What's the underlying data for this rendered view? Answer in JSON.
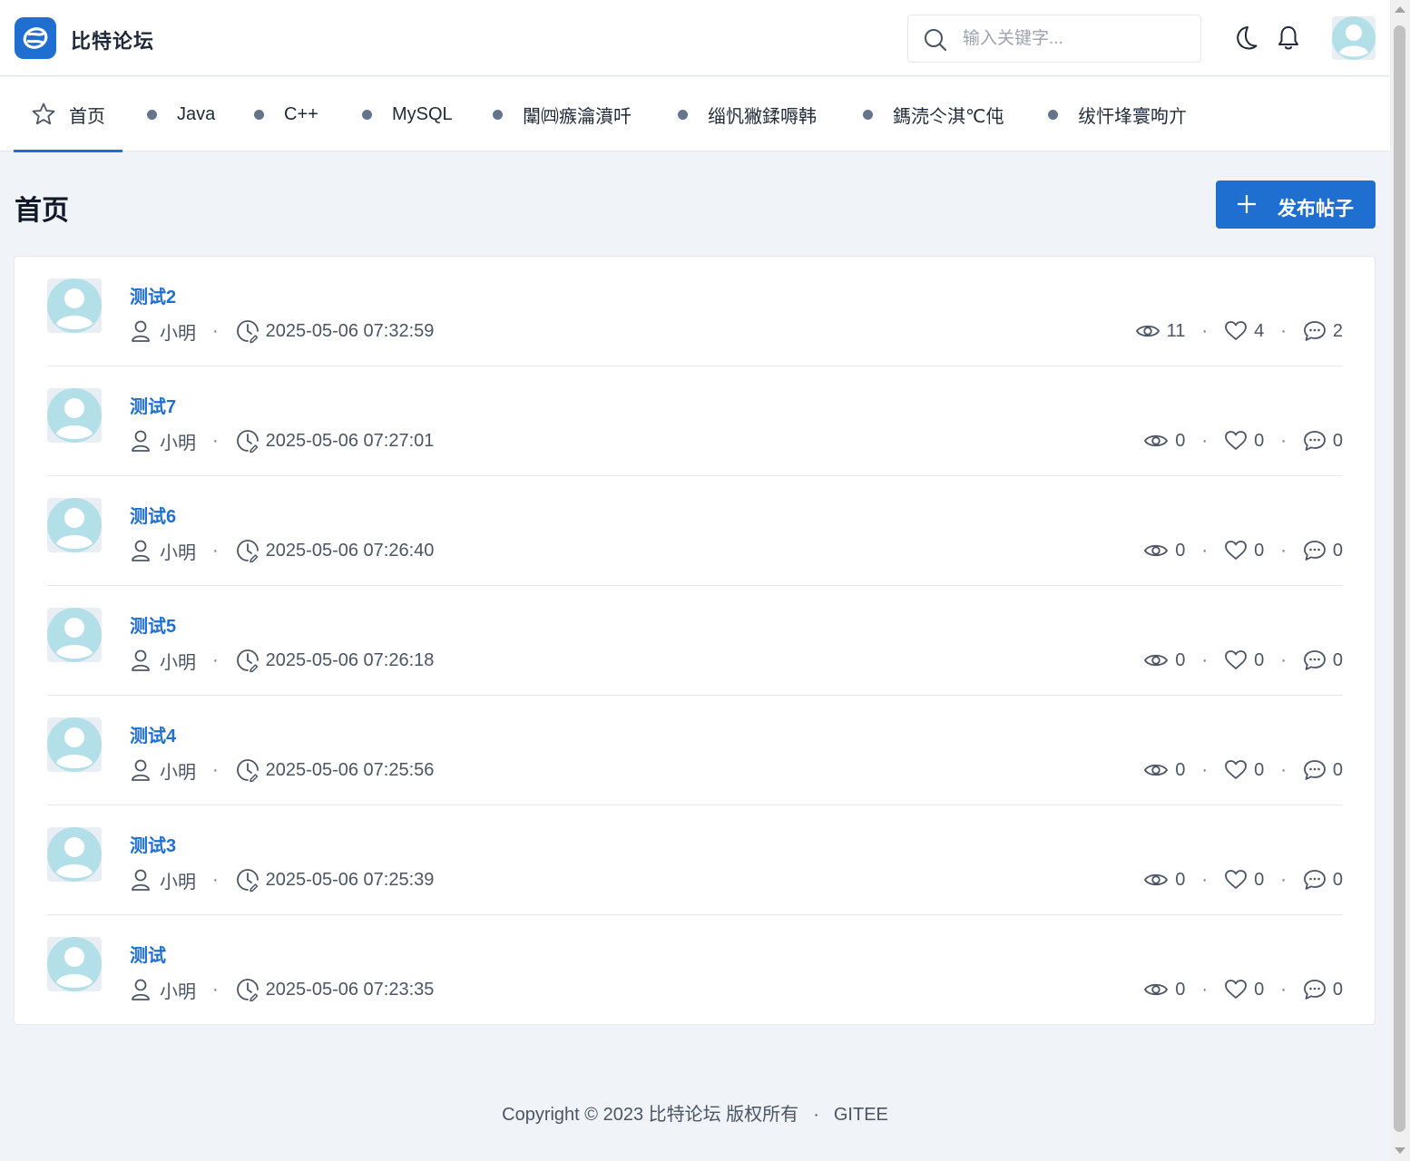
{
  "header": {
    "brand": "比特论坛",
    "search_placeholder": "输入关键字...",
    "search_value": ""
  },
  "nav": {
    "items": [
      {
        "label": "首页",
        "icon": "star-icon",
        "active": true
      },
      {
        "label": "Java"
      },
      {
        "label": "C++"
      },
      {
        "label": "MySQL"
      },
      {
        "label": "闈㈣瘯瀹濆吀"
      },
      {
        "label": "缁忛獙鍒嗕韩"
      },
      {
        "label": "鎷涜仒淇℃伅"
      },
      {
        "label": "绂忓埄寰呴亣"
      }
    ]
  },
  "page": {
    "title": "首页",
    "publish_label": "发布帖子"
  },
  "posts": [
    {
      "title": "测试2",
      "author": "小明",
      "time": "2025-05-06 07:32:59",
      "views": "11",
      "likes": "4",
      "comments": "2"
    },
    {
      "title": "测试7",
      "author": "小明",
      "time": "2025-05-06 07:27:01",
      "views": "0",
      "likes": "0",
      "comments": "0"
    },
    {
      "title": "测试6",
      "author": "小明",
      "time": "2025-05-06 07:26:40",
      "views": "0",
      "likes": "0",
      "comments": "0"
    },
    {
      "title": "测试5",
      "author": "小明",
      "time": "2025-05-06 07:26:18",
      "views": "0",
      "likes": "0",
      "comments": "0"
    },
    {
      "title": "测试4",
      "author": "小明",
      "time": "2025-05-06 07:25:56",
      "views": "0",
      "likes": "0",
      "comments": "0"
    },
    {
      "title": "测试3",
      "author": "小明",
      "time": "2025-05-06 07:25:39",
      "views": "0",
      "likes": "0",
      "comments": "0"
    },
    {
      "title": "测试",
      "author": "小明",
      "time": "2025-05-06 07:23:35",
      "views": "0",
      "likes": "0",
      "comments": "0"
    }
  ],
  "footer": {
    "copyright": "Copyright © 2023 比特论坛 版权所有",
    "separator": "·",
    "link": "GITEE"
  },
  "colors": {
    "accent": "#1f6fd0",
    "background": "#f0f4f8",
    "avatar": "#b3dfe8"
  }
}
